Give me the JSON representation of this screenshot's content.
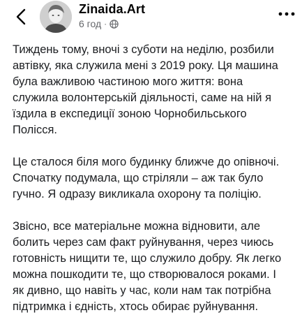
{
  "post": {
    "author": "Zinaida.Art",
    "time": "6 год",
    "separator": "·",
    "privacy_icon": "globe-icon",
    "paragraphs": [
      "Тиждень тому, вночі з суботи на неділю, розбили\nавтівку, яка служила мені з 2019 року. Ця машина\nбула важливою частиною мого життя: вона\nслужила волонтерській діяльності, саме на ній я\nїздила в експедиції зоною Чорнобильського\nПолісся.",
      "Це сталося біля мого будинку ближче до опівночі.\nСпочатку подумала, що стріляли – аж так було\nгучно. Я одразу викликала охорону та поліцію.",
      "Звісно, все матеріальне можна відновити, але\nболить через сам факт руйнування, через чиюсь\nготовність нищити те, що служило добру. Як легко\nможна пошкодити те, що створювалося роками. І\nяк дивно, що навіть у час, коли нам так потрібна\nпідтримка і єдність, хтось обирає руйнування."
    ]
  },
  "icons": {
    "back": "back-chevron-icon",
    "more": "more-dots-icon"
  }
}
